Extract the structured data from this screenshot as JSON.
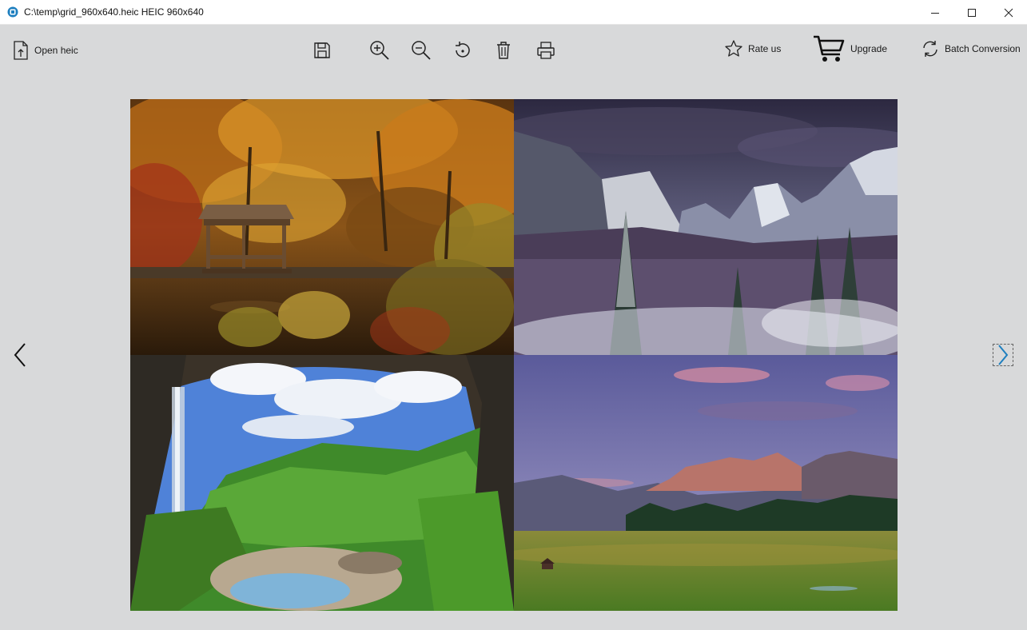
{
  "window": {
    "title": "C:\\temp\\grid_960x640.heic HEIC 960x640",
    "controls": [
      "minimize",
      "maximize",
      "close"
    ]
  },
  "toolbar": {
    "open_label": "Open heic",
    "rate_label": "Rate us",
    "upgrade_label": "Upgrade",
    "batch_label": "Batch Conversion",
    "icons": [
      "open-file-icon",
      "save-icon",
      "zoom-in-icon",
      "zoom-out-icon",
      "rotate-icon",
      "delete-icon",
      "print-icon",
      "star-icon",
      "cart-icon",
      "refresh-icon"
    ]
  },
  "viewer": {
    "image": "grid_960x640.heic",
    "tiles": [
      "autumn-lake-gazebo",
      "snowy-mountain-valley",
      "cave-waterfall",
      "meadow-sunset-mountains"
    ]
  },
  "colors": {
    "background": "#d8d9da",
    "accent": "#1e7fbf"
  }
}
